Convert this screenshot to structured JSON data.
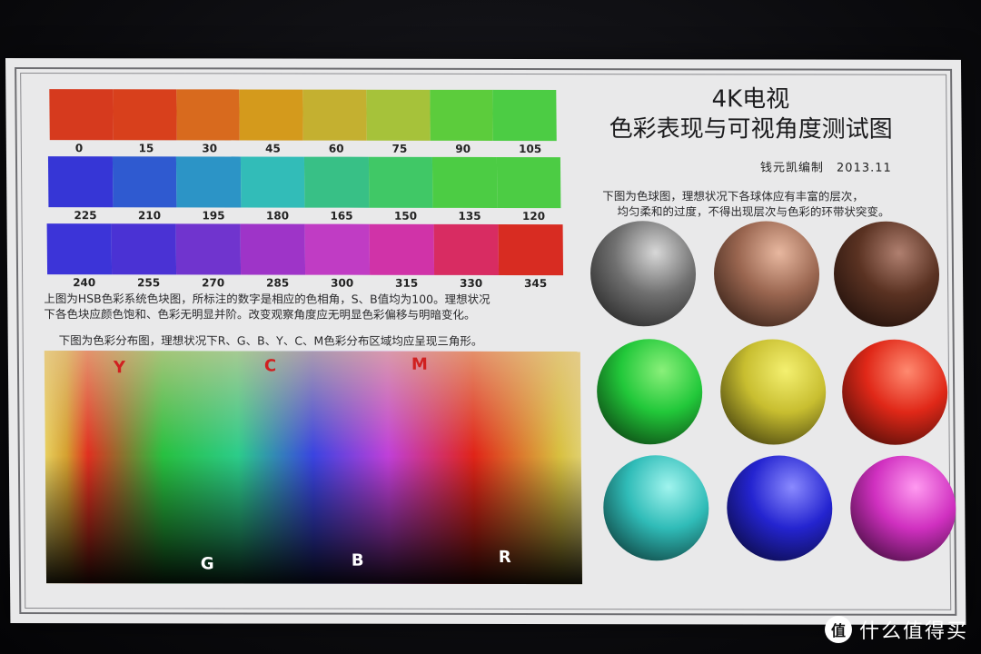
{
  "title": {
    "line1": "4K电视",
    "line2": "色彩表现与可视角度测试图"
  },
  "author": "钱元凯编制　2013.11",
  "hue_strips": [
    {
      "labels": [
        "0",
        "15",
        "30",
        "45",
        "60",
        "75",
        "90",
        "105"
      ],
      "colors": [
        "#d63a1e",
        "#d8401c",
        "#d86a1e",
        "#d49a1c",
        "#c4b030",
        "#a6c23a",
        "#5ccc3c",
        "#4ccc44"
      ]
    },
    {
      "labels": [
        "225",
        "210",
        "195",
        "180",
        "165",
        "150",
        "135",
        "120"
      ],
      "colors": [
        "#3636d6",
        "#2f5ad0",
        "#2c94c6",
        "#32bcb8",
        "#38c086",
        "#40c866",
        "#4ccc44",
        "#4ccc44"
      ]
    },
    {
      "labels": [
        "240",
        "255",
        "270",
        "285",
        "300",
        "315",
        "330",
        "345"
      ],
      "colors": [
        "#3c34d8",
        "#4a32d4",
        "#7034ce",
        "#9e34c8",
        "#c03cc4",
        "#d033a8",
        "#d82c62",
        "#d82c22"
      ]
    }
  ],
  "caption_hsb": {
    "line1": "上图为HSB色彩系统色块图，所标注的数字是相应的色相角，S、B值均为100。理想状况",
    "line2": "下各色块应颜色饱和、色彩无明显并阶。改变观察角度应无明显色彩偏移与明暗变化。"
  },
  "caption_gamut": "下图为色彩分布图，理想状况下R、G、B、Y、C、M色彩分布区域均应呈现三角形。",
  "gamut_labels": {
    "top": [
      "Y",
      "C",
      "M"
    ],
    "bottom": [
      "G",
      "B",
      "R"
    ],
    "top_color": "#d02020",
    "bottom_color": "#ffffff"
  },
  "caption_spheres": {
    "line1": "下图为色球图，理想状况下各球体应有丰富的层次，",
    "line2": "均匀柔和的过度，不得出现层次与色彩的环带状突变。"
  },
  "spheres": [
    {
      "name": "gray",
      "highlight": "#d8d8d8",
      "base": "#707070",
      "shadow": "#141414"
    },
    {
      "name": "skin-light",
      "highlight": "#e8b8a0",
      "base": "#9a6650",
      "shadow": "#1c0e08"
    },
    {
      "name": "skin-dark",
      "highlight": "#b08070",
      "base": "#5a3222",
      "shadow": "#100604"
    },
    {
      "name": "green",
      "highlight": "#8af07a",
      "base": "#22c83a",
      "shadow": "#062008"
    },
    {
      "name": "yellow",
      "highlight": "#f4f070",
      "base": "#c8be30",
      "shadow": "#201e04"
    },
    {
      "name": "red",
      "highlight": "#ff8a70",
      "base": "#e02818",
      "shadow": "#280604"
    },
    {
      "name": "cyan",
      "highlight": "#a0f4ee",
      "base": "#30bcb8",
      "shadow": "#04201e"
    },
    {
      "name": "blue",
      "highlight": "#8a8aff",
      "base": "#2424d0",
      "shadow": "#04041e"
    },
    {
      "name": "magenta",
      "highlight": "#ff9af0",
      "base": "#d030c0",
      "shadow": "#22041e"
    }
  ],
  "watermark": {
    "logo_text": "值",
    "text": "什么值得买",
    "color": "#ffffff"
  }
}
